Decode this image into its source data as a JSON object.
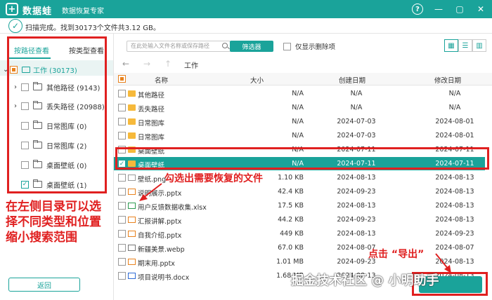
{
  "title": {
    "logo_char": "+",
    "app_name": "数据蛙",
    "subtitle": "数据恢复专家"
  },
  "window_controls": {
    "help": "?",
    "minimize": "—",
    "maximize": "▢",
    "close": "✕"
  },
  "scan": {
    "status": "扫描完成。找到30173个文件共3.12 GB。"
  },
  "sidebar": {
    "tab_path": "按路径查看",
    "tab_type": "按类型查看",
    "root": {
      "label": "工作 (30173)"
    },
    "items": [
      {
        "label": "其他路径 (9143)",
        "expand": true,
        "checked": false
      },
      {
        "label": "丢失路径 (20988)",
        "expand": true,
        "checked": false
      },
      {
        "label": "日常图库 (0)",
        "expand": false,
        "checked": false
      },
      {
        "label": "日常图库 (2)",
        "expand": false,
        "checked": false
      },
      {
        "label": "桌面壁纸 (0)",
        "expand": false,
        "checked": false
      },
      {
        "label": "桌面壁纸 (1)",
        "expand": false,
        "checked": true
      }
    ],
    "back_label": "返回"
  },
  "toolbar": {
    "search_placeholder": "在此处输入文件名称或保存路径",
    "filter_label": "筛选器",
    "only_deleted_label": "仅显示删除项"
  },
  "nav": {
    "path": "工作"
  },
  "table": {
    "col_name": "名称",
    "col_size": "大小",
    "col_created": "创建日期",
    "col_modified": "修改日期",
    "rows": [
      {
        "name": "其他路径",
        "size": "N/A",
        "created": "N/A",
        "modified": "N/A",
        "type": "folder"
      },
      {
        "name": "丢失路径",
        "size": "N/A",
        "created": "N/A",
        "modified": "N/A",
        "type": "folder"
      },
      {
        "name": "日常图库",
        "size": "N/A",
        "created": "2024-07-03",
        "modified": "2024-08-01",
        "type": "folder"
      },
      {
        "name": "日常图库",
        "size": "N/A",
        "created": "2024-07-03",
        "modified": "2024-08-01",
        "type": "folder"
      },
      {
        "name": "桌面壁纸",
        "size": "N/A",
        "created": "2024-07-11",
        "modified": "2024-07-11",
        "type": "folder"
      },
      {
        "name": "桌面壁纸",
        "size": "N/A",
        "created": "2024-07-11",
        "modified": "2024-07-11",
        "type": "folder",
        "selected": true
      },
      {
        "name": "壁纸.png",
        "size": "1.10 KB",
        "created": "2024-08-13",
        "modified": "2024-08-13",
        "type": "png"
      },
      {
        "name": "说明展示.pptx",
        "size": "42.4 KB",
        "created": "2024-09-23",
        "modified": "2024-08-13",
        "type": "pptx"
      },
      {
        "name": "用户反馈数据收集.xlsx",
        "size": "17.5 KB",
        "created": "2024-08-13",
        "modified": "2024-08-13",
        "type": "xlsx"
      },
      {
        "name": "汇报讲解.pptx",
        "size": "44.2 KB",
        "created": "2024-09-23",
        "modified": "2024-08-13",
        "type": "pptx"
      },
      {
        "name": "自我介绍.pptx",
        "size": "449 KB",
        "created": "2024-08-13",
        "modified": "2024-09-23",
        "type": "pptx"
      },
      {
        "name": "新疆美景.webp",
        "size": "67.0 KB",
        "created": "2024-08-07",
        "modified": "2024-08-07",
        "type": "webp"
      },
      {
        "name": "期末用.pptx",
        "size": "1.01 MB",
        "created": "2024-09-23",
        "modified": "2024-08-13",
        "type": "pptx"
      },
      {
        "name": "项目说明书.docx",
        "size": "1.68 MB",
        "created": "2024-08-13",
        "modified": "2024-08-13",
        "type": "docx"
      }
    ]
  },
  "export": {
    "label": "导出"
  },
  "annotations": {
    "left_text": "在左侧目录可以选择不同类型和位置缩小搜索范围",
    "check_text": "勾选出需要恢复的文件",
    "export_text": "点击 “导出”"
  },
  "watermark": "掘金技术社区 @ 小明助手",
  "colors": {
    "accent": "#1aa39a",
    "annotation_red": "#e02020",
    "partial": "#e8821e"
  }
}
